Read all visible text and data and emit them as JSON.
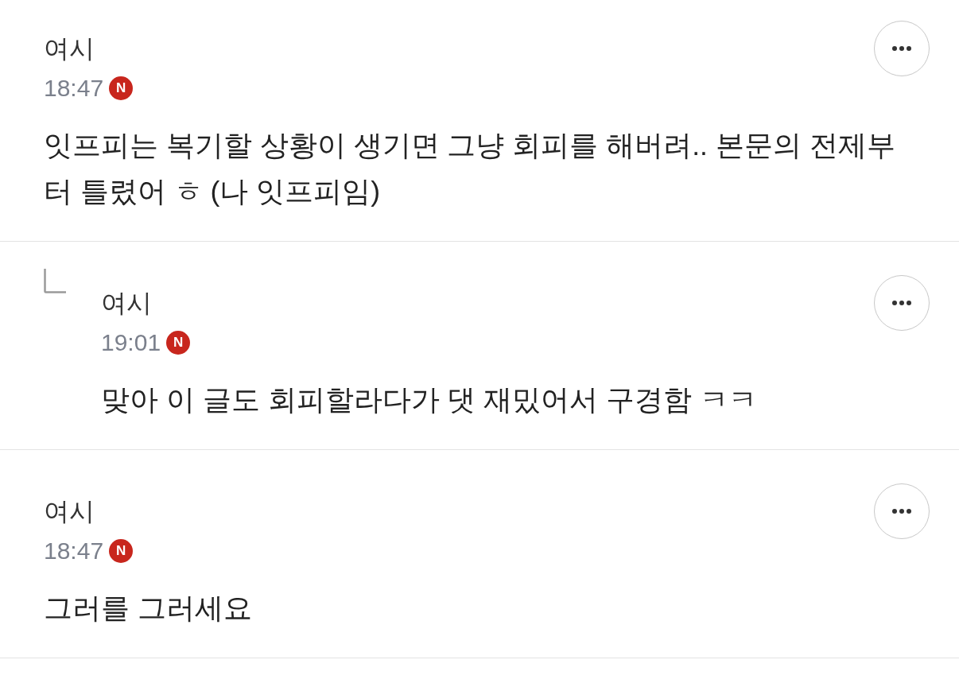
{
  "comments": [
    {
      "kind": "comment",
      "author": "여시",
      "time": "18:47",
      "badge": "N",
      "text": "잇프피는 복기할 상황이 생기면 그냥 회피를 해버려.. 본문의 전제부터 틀렸어 ㅎ (나 잇프피임)"
    },
    {
      "kind": "reply",
      "author": "여시",
      "time": "19:01",
      "badge": "N",
      "text": "맞아 이 글도 회피할라다가 댓 재밌어서 구경함 ㅋㅋ"
    },
    {
      "kind": "comment",
      "author": "여시",
      "time": "18:47",
      "badge": "N",
      "text": "그러를 그러세요"
    }
  ]
}
